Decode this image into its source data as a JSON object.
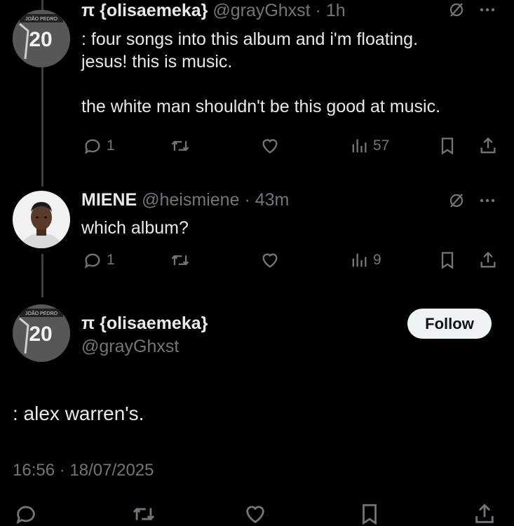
{
  "replies": [
    {
      "name": "π {olisaemeka}",
      "handle": "@grayGhxst",
      "time": "1h",
      "lines": [
        ": four songs into this album and i'm floating.",
        "jesus! this is music.",
        "",
        "the white man shouldn't be this good at music."
      ],
      "reply_count": "1",
      "views": "57",
      "avatar_text": "20",
      "avatar_small_text": "JOÃO PEDRO"
    },
    {
      "name": "MIENE",
      "handle": "@heismiene",
      "time": "43m",
      "lines": [
        "which album?"
      ],
      "reply_count": "1",
      "views": "9"
    }
  ],
  "main": {
    "name": "π {olisaemeka}",
    "handle": "@grayGhxst",
    "follow_label": "Follow",
    "text": ": alex warren's.",
    "timestamp": "16:56 · 18/07/2025",
    "avatar_text": "20",
    "avatar_small_text": "JOÃO PEDRO"
  },
  "separator": "·",
  "icons": {
    "reply": "reply-icon",
    "retweet": "retweet-icon",
    "like": "heart-icon",
    "views": "views-icon",
    "bookmark": "bookmark-icon",
    "share": "share-icon",
    "grok": "grok-icon",
    "more": "more-icon"
  },
  "colors": {
    "background": "#000000",
    "text": "#e7e9ea",
    "muted": "#71767b",
    "follow_bg": "#eff3f4"
  }
}
